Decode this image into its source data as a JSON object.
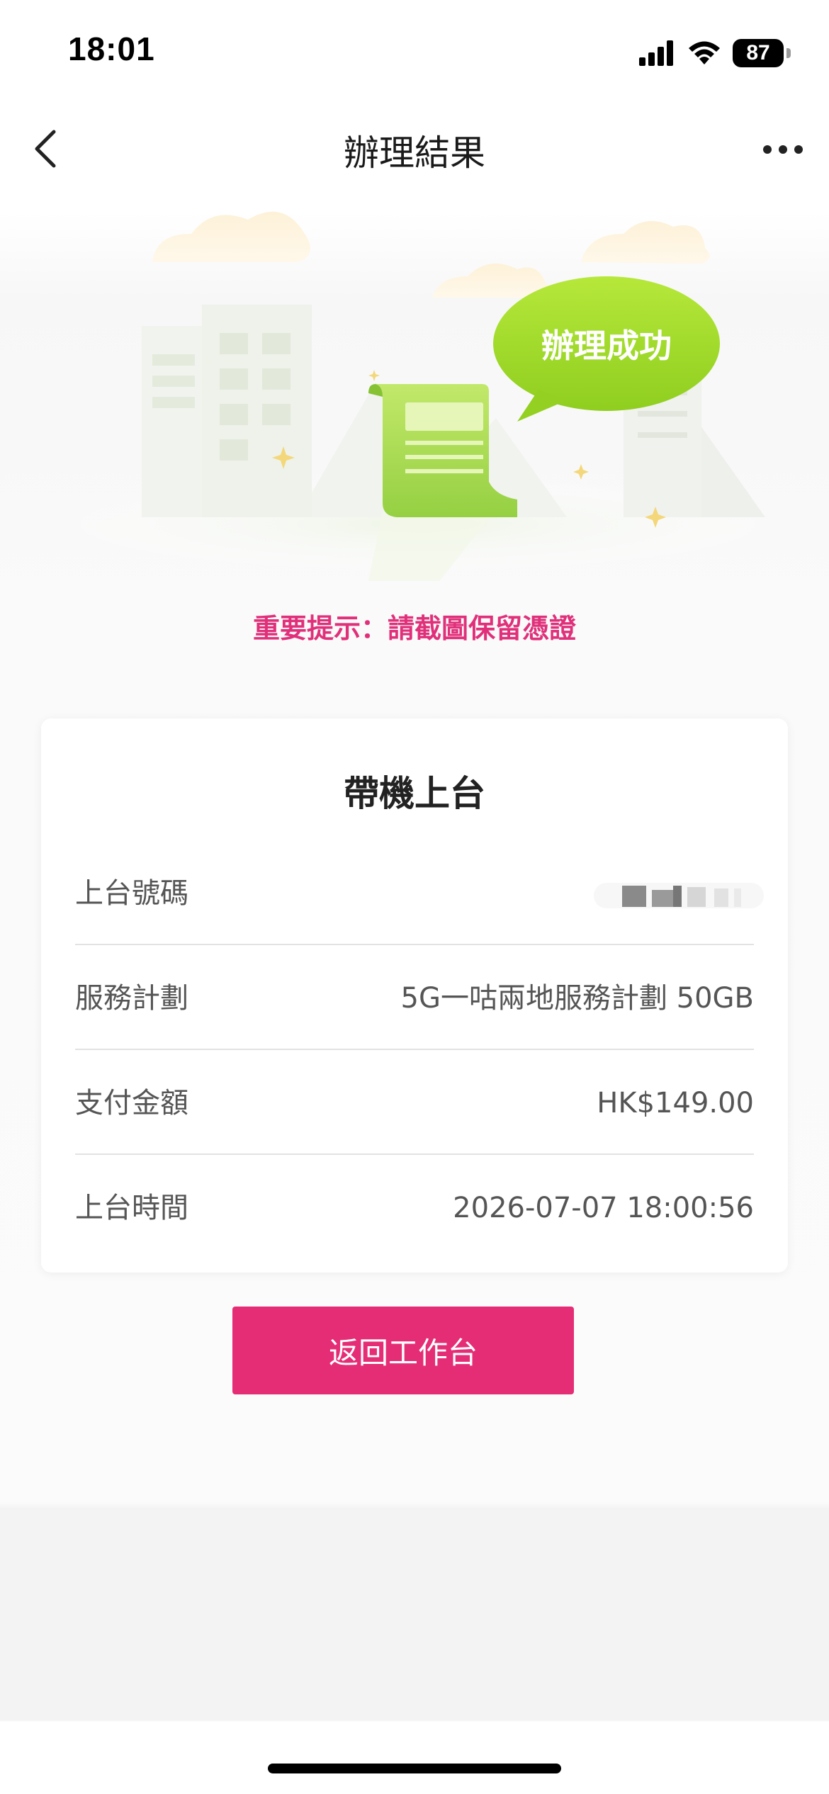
{
  "status_bar": {
    "time": "18:01",
    "battery": "87",
    "icons": [
      "cellular-signal-icon",
      "wifi-icon",
      "battery-icon"
    ]
  },
  "nav": {
    "title": "辦理結果",
    "back_icon": "chevron-left-icon",
    "more_icon": "more-dots-icon"
  },
  "illustration": {
    "bubble_text": "辦理成功"
  },
  "notice": "重要提示：請截圖保留憑證",
  "card": {
    "title": "帶機上台",
    "rows": [
      {
        "label": "上台號碼",
        "value": ""
      },
      {
        "label": "服務計劃",
        "value": "5G一咕兩地服務計劃 50GB"
      },
      {
        "label": "支付金額",
        "value": "HK$149.00"
      },
      {
        "label": "上台時間",
        "value": "2026-07-07 18:00:56"
      }
    ]
  },
  "return_button": "返回工作台",
  "colors": {
    "accent": "#e52d76",
    "notice_text": "#e0307a",
    "bubble_green": "#9ed92c",
    "receipt_green": "#b5e05a"
  }
}
